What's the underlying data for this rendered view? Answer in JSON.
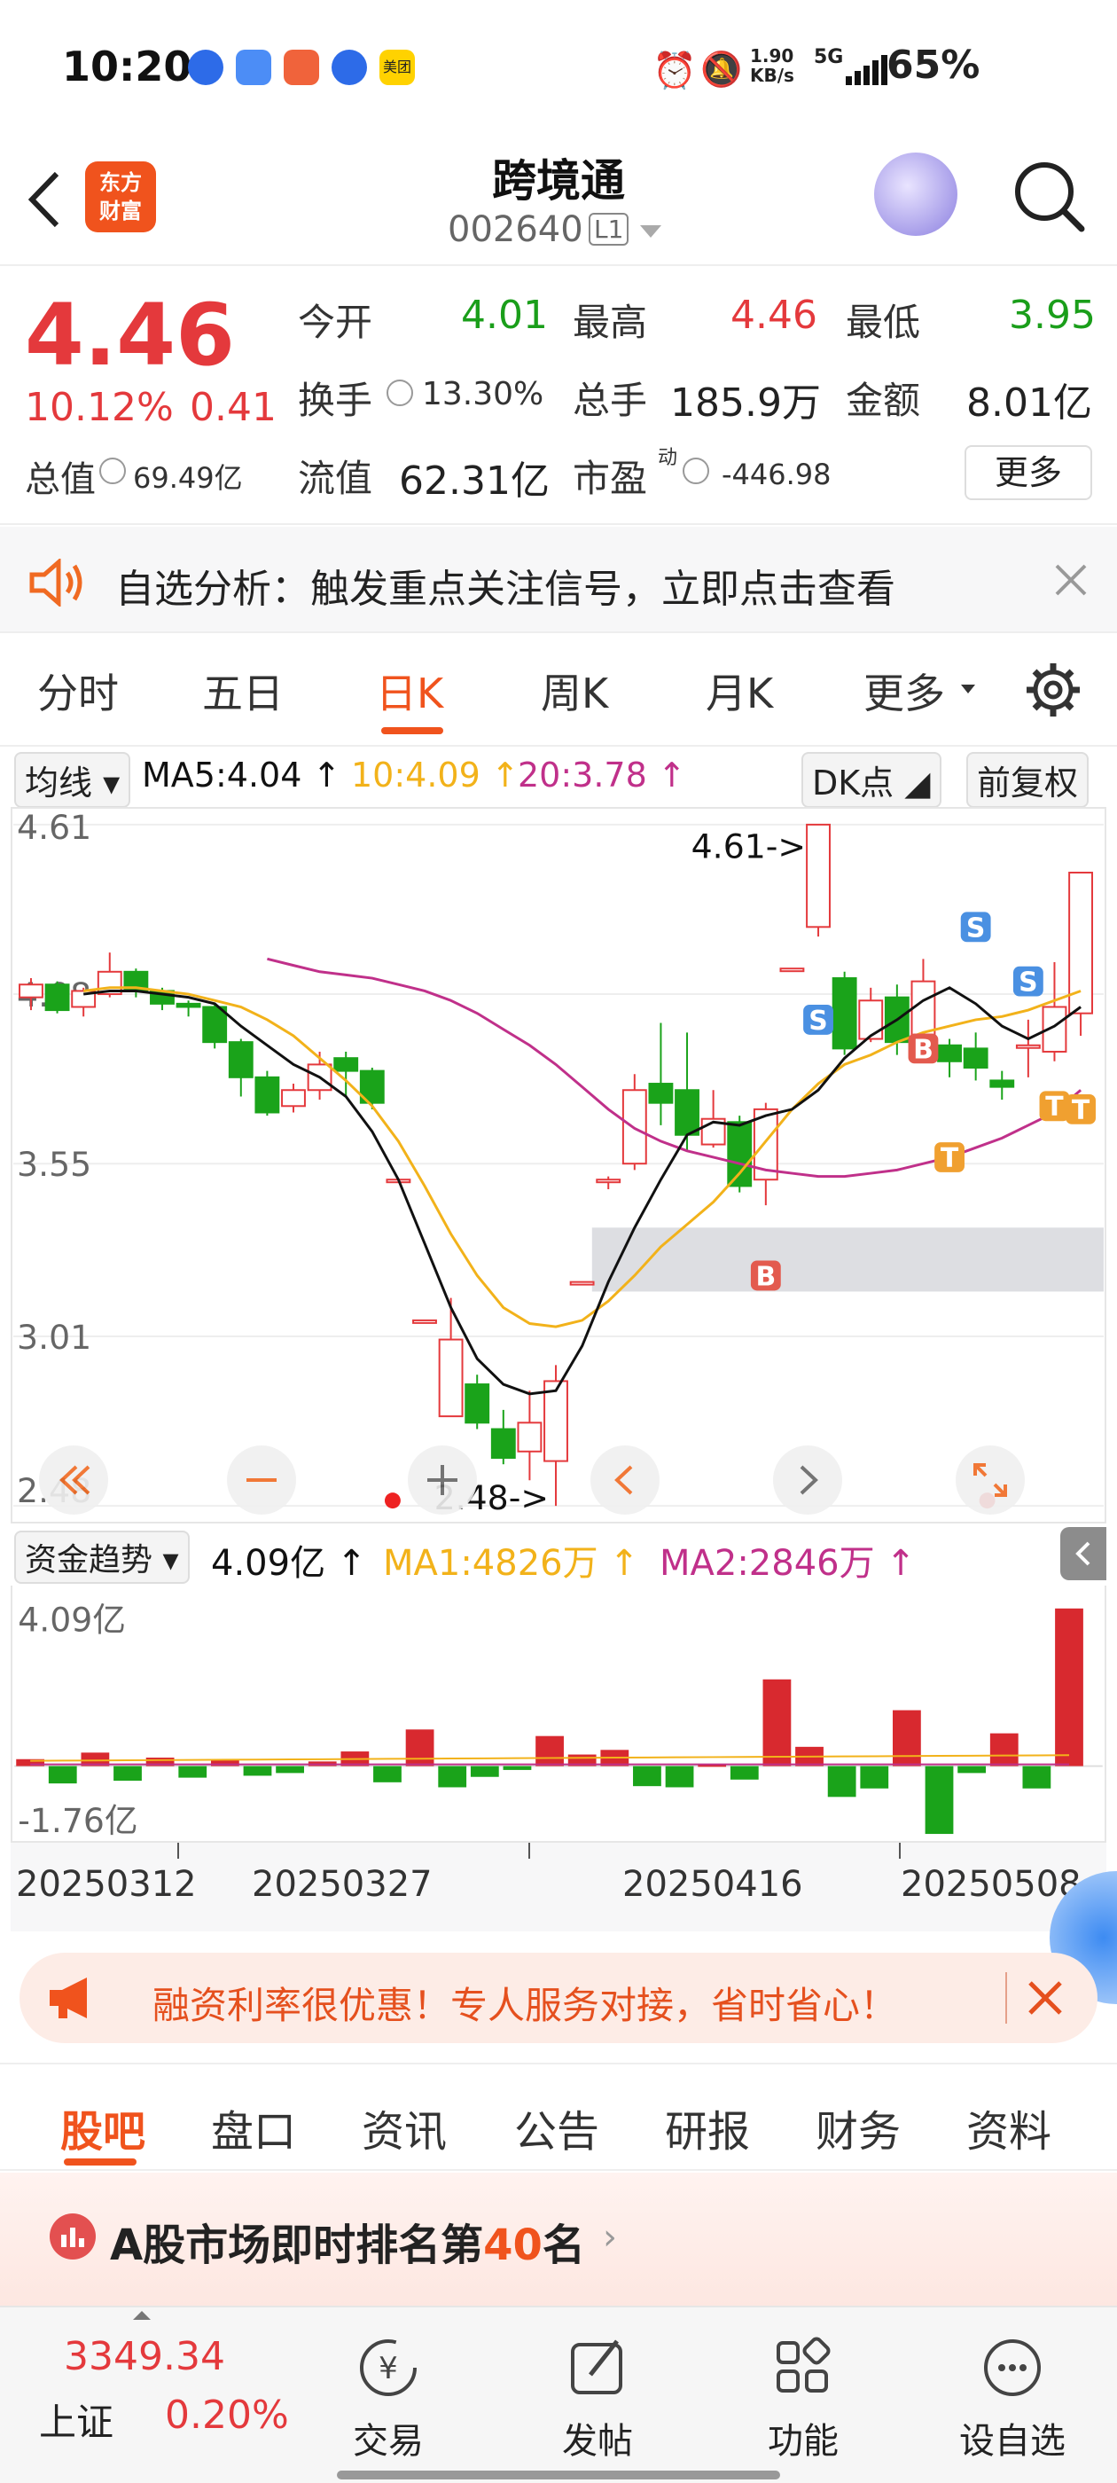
{
  "status": {
    "time": "10:20",
    "speed_top": "1.90",
    "speed_unit": "KB/s",
    "network": "5G",
    "battery": "65%",
    "app_label": "美团"
  },
  "nav": {
    "title": "跨境通",
    "code": "002640",
    "level": "L1",
    "brand_line1": "东方",
    "brand_line2": "财富"
  },
  "quote": {
    "price": "4.46",
    "change_pct": "10.12%",
    "change": "0.41",
    "open_label": "今开",
    "open": "4.01",
    "high_label": "最高",
    "high": "4.46",
    "low_label": "最低",
    "low": "3.95",
    "turnover_label": "换手",
    "turnover": "13.30%",
    "volume_label": "总手",
    "volume": "185.9万",
    "amount_label": "金额",
    "amount": "8.01亿",
    "mcap_label": "总值",
    "mcap": "69.49亿",
    "float_label": "流值",
    "float_cap": "62.31亿",
    "pe_label": "市盈",
    "pe_sup": "动",
    "pe": "-446.98",
    "more": "更多"
  },
  "signal": {
    "text": "自选分析：触发重点关注信号，立即点击查看"
  },
  "ktabs": [
    "分时",
    "五日",
    "日K",
    "周K",
    "月K",
    "更多"
  ],
  "ma": {
    "selector": "均线",
    "ma5": "MA5:4.04 ↑",
    "ma10": "10:4.09 ↑",
    "ma20": "20:3.78 ↑",
    "dk": "DK点",
    "adjust": "前复权"
  },
  "chart_data": {
    "type": "candlestick",
    "ylim": [
      2.48,
      4.61
    ],
    "yticks": [
      "4.61",
      "4.08",
      "3.55",
      "3.01",
      "2.48"
    ],
    "high_label": "4.61->",
    "low_label": "2.48->",
    "dates": [
      "20250312",
      "20250327",
      "20250416",
      "20250508"
    ],
    "candles": [
      [
        4.07,
        4.11,
        4.13,
        4.03
      ],
      [
        4.11,
        4.03,
        4.12,
        4.02
      ],
      [
        4.04,
        4.09,
        4.1,
        4.01
      ],
      [
        4.08,
        4.15,
        4.21,
        4.07
      ],
      [
        4.15,
        4.09,
        4.16,
        4.07
      ],
      [
        4.09,
        4.05,
        4.1,
        4.03
      ],
      [
        4.05,
        4.04,
        4.06,
        4.01
      ],
      [
        4.04,
        3.93,
        4.05,
        3.91
      ],
      [
        3.93,
        3.82,
        3.94,
        3.76
      ],
      [
        3.82,
        3.71,
        3.84,
        3.7
      ],
      [
        3.73,
        3.78,
        3.8,
        3.71
      ],
      [
        3.78,
        3.86,
        3.9,
        3.75
      ],
      [
        3.88,
        3.84,
        3.9,
        3.76
      ],
      [
        3.84,
        3.74,
        3.85,
        3.72
      ],
      [
        3.5,
        3.5,
        3.5,
        3.5
      ],
      [
        3.06,
        3.06,
        3.06,
        3.06
      ],
      [
        2.76,
        3.0,
        3.13,
        2.76
      ],
      [
        2.86,
        2.74,
        2.89,
        2.72
      ],
      [
        2.72,
        2.63,
        2.78,
        2.61
      ],
      [
        2.65,
        2.74,
        2.84,
        2.56
      ],
      [
        2.62,
        2.87,
        2.92,
        2.48
      ],
      [
        3.18,
        3.18,
        3.18,
        3.18
      ],
      [
        3.5,
        3.5,
        3.51,
        3.47
      ],
      [
        3.55,
        3.78,
        3.83,
        3.53
      ],
      [
        3.8,
        3.74,
        3.99,
        3.67
      ],
      [
        3.78,
        3.64,
        3.96,
        3.59
      ],
      [
        3.61,
        3.69,
        3.78,
        3.6
      ],
      [
        3.68,
        3.48,
        3.7,
        3.46
      ],
      [
        3.5,
        3.72,
        3.74,
        3.42
      ],
      [
        4.16,
        4.16,
        4.16,
        4.16
      ],
      [
        4.29,
        4.61,
        4.61,
        4.26
      ],
      [
        4.13,
        3.91,
        4.15,
        3.89
      ],
      [
        3.94,
        4.06,
        4.1,
        3.93
      ],
      [
        4.07,
        3.93,
        4.11,
        3.89
      ],
      [
        3.93,
        4.12,
        4.19,
        3.91
      ],
      [
        3.92,
        3.87,
        3.94,
        3.82
      ],
      [
        3.91,
        3.85,
        3.96,
        3.81
      ],
      [
        3.81,
        3.79,
        3.84,
        3.75
      ],
      [
        3.92,
        3.92,
        4.0,
        3.82
      ],
      [
        3.9,
        4.04,
        4.18,
        3.87
      ],
      [
        4.02,
        4.46,
        4.46,
        3.95
      ]
    ],
    "ma5": [
      4.08,
      4.09,
      4.09,
      4.08,
      4.07,
      4.05,
      3.98,
      3.92,
      3.86,
      3.82,
      3.76,
      3.65,
      3.5,
      3.3,
      3.1,
      2.94,
      2.86,
      2.83,
      2.84,
      2.98,
      3.18,
      3.35,
      3.5,
      3.64,
      3.68,
      3.67,
      3.7,
      3.72,
      3.78,
      3.88,
      3.95,
      4.0,
      4.06,
      4.1,
      4.05,
      3.98,
      3.94,
      3.98,
      4.04
    ],
    "ma10": [
      4.09,
      4.1,
      4.1,
      4.09,
      4.08,
      4.06,
      4.04,
      4.0,
      3.95,
      3.88,
      3.81,
      3.73,
      3.62,
      3.48,
      3.33,
      3.2,
      3.1,
      3.05,
      3.04,
      3.06,
      3.12,
      3.2,
      3.29,
      3.36,
      3.43,
      3.52,
      3.62,
      3.72,
      3.8,
      3.86,
      3.89,
      3.93,
      3.96,
      3.98,
      4.0,
      4.01,
      4.03,
      4.06,
      4.09
    ],
    "ma20": [
      4.19,
      4.17,
      4.15,
      4.14,
      4.13,
      4.11,
      4.09,
      4.06,
      4.02,
      3.97,
      3.92,
      3.86,
      3.79,
      3.72,
      3.66,
      3.62,
      3.59,
      3.57,
      3.55,
      3.53,
      3.52,
      3.51,
      3.51,
      3.52,
      3.53,
      3.55,
      3.57,
      3.6,
      3.63,
      3.67,
      3.71,
      3.78
    ],
    "signals": [
      "S",
      "S",
      "B",
      "B",
      "T",
      "T",
      "S",
      "T"
    ],
    "fund": {
      "selector": "资金趋势",
      "value": "4.09亿 ↑",
      "ma1": "MA1:4826万 ↑",
      "ma2": "MA2:2846万 ↑",
      "top": "4.09亿",
      "bottom": "-1.76亿",
      "bars": [
        0.18,
        -0.45,
        0.35,
        -0.38,
        0.22,
        -0.3,
        0.15,
        -0.25,
        -0.18,
        0.12,
        0.38,
        -0.42,
        0.95,
        -0.55,
        -0.28,
        -0.1,
        0.78,
        0.3,
        0.42,
        -0.52,
        -0.55,
        0.05,
        -0.35,
        2.25,
        0.5,
        -0.8,
        -0.58,
        1.45,
        -1.76,
        -0.18,
        0.85,
        -0.58,
        4.09
      ]
    }
  },
  "ad": {
    "text": "融资利率很优惠！专人服务对接，省时省心！"
  },
  "ftabs": [
    "股吧",
    "盘口",
    "资讯",
    "公告",
    "研报",
    "财务",
    "资料"
  ],
  "rank": {
    "prefix": "A股市场即时排名第",
    "num": "40",
    "suffix": "名"
  },
  "bottom": {
    "index_value": "3349.34",
    "index_name": "上证",
    "index_pct": "0.20%",
    "trade": "交易",
    "post": "发帖",
    "func": "功能",
    "watch": "设自选"
  }
}
